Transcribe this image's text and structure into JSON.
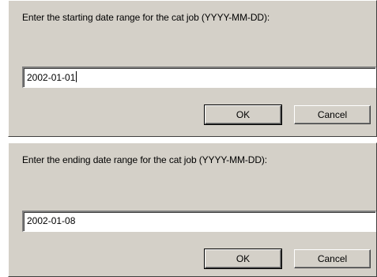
{
  "dialogs": [
    {
      "prompt": "Enter the starting date range for the cat job (YYYY-MM-DD):",
      "value": "2002-01-01",
      "ok_label": "OK",
      "cancel_label": "Cancel",
      "focused": true
    },
    {
      "prompt": "Enter the ending date range for the cat job (YYYY-MM-DD):",
      "value": "2002-01-08",
      "ok_label": "OK",
      "cancel_label": "Cancel",
      "focused": false
    }
  ],
  "colors": {
    "dialog_face": "#d4d0c8",
    "field_bg": "#ffffff",
    "shadow": "#808080",
    "dark_shadow": "#404040"
  }
}
